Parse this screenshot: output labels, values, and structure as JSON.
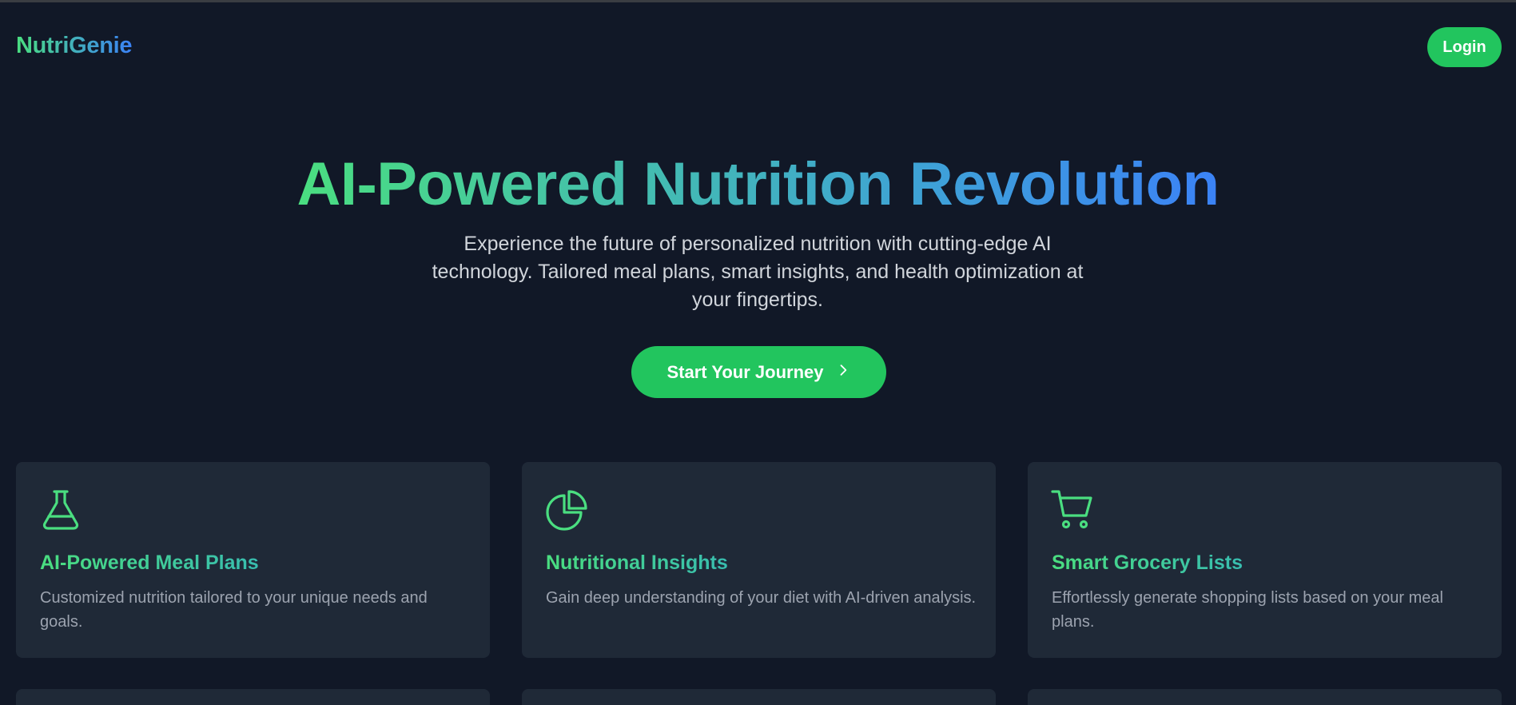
{
  "brand": {
    "name": "NutriGenie"
  },
  "nav": {
    "login_label": "Login"
  },
  "hero": {
    "title": "AI-Powered Nutrition Revolution",
    "subtitle": "Experience the future of personalized nutrition with cutting-edge AI technology. Tailored meal plans, smart insights, and health optimization at your fingertips.",
    "cta_label": "Start Your Journey"
  },
  "features": [
    {
      "icon": "flask-icon",
      "title": "AI-Powered Meal Plans",
      "description": "Customized nutrition tailored to your unique needs and goals."
    },
    {
      "icon": "pie-chart-icon",
      "title": "Nutritional Insights",
      "description": "Gain deep understanding of your diet with AI-driven analysis."
    },
    {
      "icon": "shopping-cart-icon",
      "title": "Smart Grocery Lists",
      "description": "Effortlessly generate shopping lists based on your meal plans."
    }
  ],
  "colors": {
    "background": "#111827",
    "card": "#1f2937",
    "accent": "#22c55e",
    "gradient_start": "#4ade80",
    "gradient_end": "#3b82f6"
  }
}
